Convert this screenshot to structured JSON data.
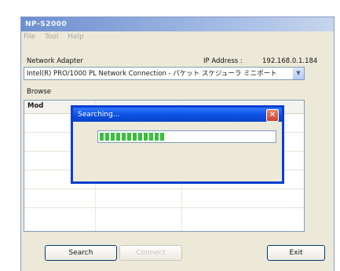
{
  "window": {
    "title": "NP-S2000",
    "menu": [
      "File",
      "Tool",
      "Help"
    ]
  },
  "network": {
    "adapter_label": "Network Adapter",
    "ip_label": "IP Address :",
    "ip_value": "192.168.0.1.184",
    "adapter_value": "Intel(R) PRO/1000 PL Network Connection - パケット スケジューラ ミニポート",
    "browse_label": "Browse"
  },
  "list": {
    "column_label": "Mod"
  },
  "buttons": {
    "search": "Search",
    "connect": "Connect",
    "exit": "Exit"
  },
  "dialog": {
    "title": "Searching...",
    "close_glyph": "✕",
    "progress_value": 0.38
  },
  "colors": {
    "progress_fill": "#37c13a",
    "dialog_title": "#0b4fe0",
    "close_button": "#c9452b"
  }
}
